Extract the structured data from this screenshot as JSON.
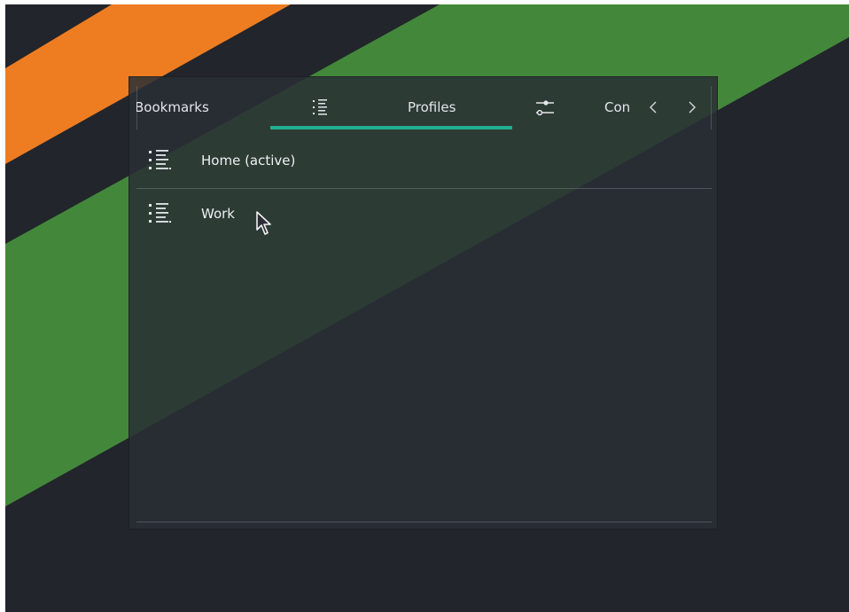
{
  "colors": {
    "desktop_bg": "#22252b",
    "stripe_orange": "#ee7d22",
    "stripe_green": "#43883a",
    "accent": "#1fae8e",
    "popup_bg": "#2a2e34",
    "text": "#e3e6ea"
  },
  "tabs": [
    {
      "label": "Bookmarks",
      "icon": null,
      "active": false
    },
    {
      "label": "Profiles",
      "icon": "list-icon",
      "active": true
    },
    {
      "label": "Con",
      "icon": "sliders-icon",
      "active": false
    }
  ],
  "nav": {
    "prev_icon": "chevron-left-icon",
    "next_icon": "chevron-right-icon"
  },
  "profiles": {
    "items": [
      {
        "label": "Home (active)",
        "icon": "list-icon"
      },
      {
        "label": "Work",
        "icon": "list-icon"
      }
    ]
  },
  "cursor": {
    "icon": "pointer-cursor-icon"
  }
}
